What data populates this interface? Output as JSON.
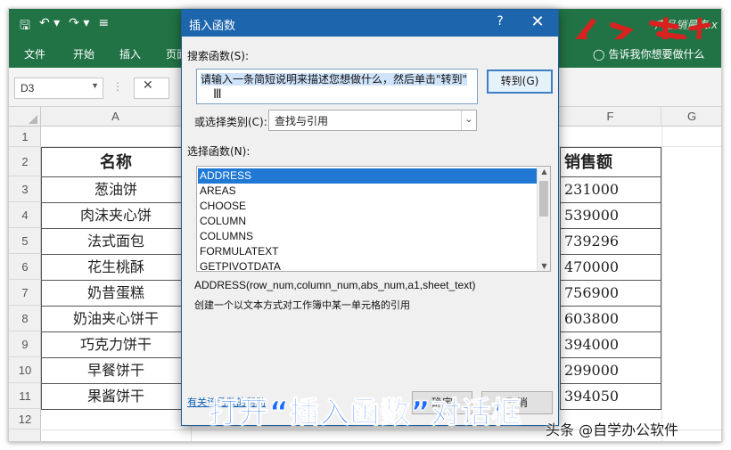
{
  "window": {
    "title": "产品销量表.x",
    "qat_icons": [
      "save-icon",
      "undo-icon",
      "redo-icon",
      "customize-qat-icon"
    ]
  },
  "ribbon": {
    "tabs": [
      "文件",
      "开始",
      "插入",
      "页面"
    ],
    "tell_me": "告诉我你想要做什么",
    "accent_color": "#217346"
  },
  "formula_bar": {
    "name_box": "D3",
    "cancel_symbol": "✕"
  },
  "columns": [
    "A",
    "F",
    "G"
  ],
  "rows": [
    "1",
    "2",
    "3",
    "4",
    "5",
    "6",
    "7",
    "8",
    "9",
    "10",
    "11",
    "12"
  ],
  "sheet": {
    "a_header": "名称",
    "a_values": [
      "葱油饼",
      "肉沫夹心饼",
      "法式面包",
      "花生桃酥",
      "奶昔蛋糕",
      "奶油夹心饼干",
      "巧克力饼干",
      "早餐饼干",
      "果酱饼干"
    ],
    "f_header": "销售额",
    "f_values": [
      "231000",
      "539000",
      "739296",
      "470000",
      "756900",
      "603800",
      "394000",
      "299000",
      "394050"
    ]
  },
  "dialog": {
    "title": "插入函数",
    "help": "?",
    "close": "✕",
    "search_label": "搜索函数(S):",
    "search_text": "请输入一条简短说明来描述您想做什么，然后单击\"转到\"",
    "goto_label": "转到(G)",
    "category_label": "或选择类别(C):",
    "category_value": "查找与引用",
    "select_label": "选择函数(N):",
    "functions": [
      "ADDRESS",
      "AREAS",
      "CHOOSE",
      "COLUMN",
      "COLUMNS",
      "FORMULATEXT",
      "GETPIVOTDATA"
    ],
    "selected_function": "ADDRESS",
    "syntax": "ADDRESS(row_num,column_num,abs_num,a1,sheet_text)",
    "description": "创建一个以文本方式对工作簿中某一单元格的引用",
    "help_link": "有关该函数的帮助",
    "ok": "确定",
    "cancel": "取消",
    "accent_color": "#1d65ad"
  },
  "overlay": {
    "caption": "打开“插入函数”对话框",
    "caption_color": "#1c6cff",
    "watermark": "头条 @自学办公软件"
  }
}
